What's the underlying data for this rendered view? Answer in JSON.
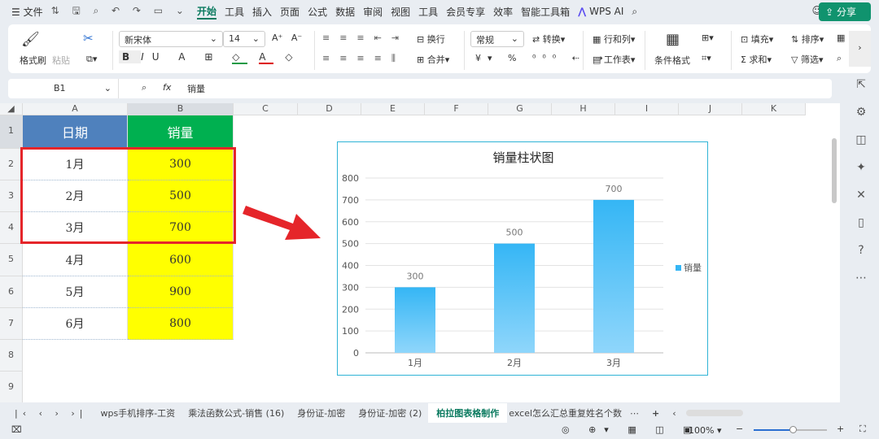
{
  "menu": {
    "file": "文件",
    "tabs": [
      "开始",
      "工具",
      "插入",
      "页面",
      "公式",
      "数据",
      "审阅",
      "视图",
      "工具",
      "会员专享",
      "效率",
      "智能工具箱"
    ],
    "wps_ai": "WPS AI",
    "share": "分享"
  },
  "ribbon": {
    "format_painter": "格式刷",
    "paste": "粘贴",
    "font": "新宋体",
    "size": "14",
    "wrap": "换行",
    "merge": "合并",
    "number_format": "常规",
    "convert": "转换",
    "rows_cols": "行和列",
    "worksheet": "工作表",
    "cond_format": "条件格式",
    "fill": "填充",
    "sort": "排序",
    "sum": "求和",
    "filter": "筛选"
  },
  "formula": {
    "cell_ref": "B1",
    "fx": "fx",
    "value": "销量"
  },
  "columns": [
    "A",
    "B",
    "C",
    "D",
    "E",
    "F",
    "G",
    "H",
    "I",
    "J",
    "K"
  ],
  "rows": [
    "1",
    "2",
    "3",
    "4",
    "5",
    "6",
    "7",
    "8",
    "9"
  ],
  "table": {
    "headers": [
      "日期",
      "销量"
    ],
    "data": [
      [
        "1月",
        "300"
      ],
      [
        "2月",
        "500"
      ],
      [
        "3月",
        "700"
      ],
      [
        "4月",
        "600"
      ],
      [
        "5月",
        "900"
      ],
      [
        "6月",
        "800"
      ]
    ],
    "header_colors": [
      "#4f81bd",
      "#00b050"
    ],
    "value_bg": "#ffff00"
  },
  "chart_data": {
    "type": "bar",
    "title": "销量柱状图",
    "categories": [
      "1月",
      "2月",
      "3月"
    ],
    "series": [
      {
        "name": "销量",
        "values": [
          300,
          500,
          700
        ]
      }
    ],
    "ylim": [
      0,
      800
    ],
    "yticks": [
      "0",
      "100",
      "200",
      "300",
      "400",
      "500",
      "600",
      "700",
      "800"
    ],
    "legend": "right",
    "grid": true
  },
  "sheets": {
    "tabs": [
      "wps手机排序-工资",
      "乘法函数公式-销售 (16)",
      "身份证-加密",
      "身份证-加密 (2)",
      "柏拉图表格制作",
      "excel怎么汇总重复姓名个数"
    ],
    "active": 4
  },
  "status": {
    "zoom": "100%"
  }
}
